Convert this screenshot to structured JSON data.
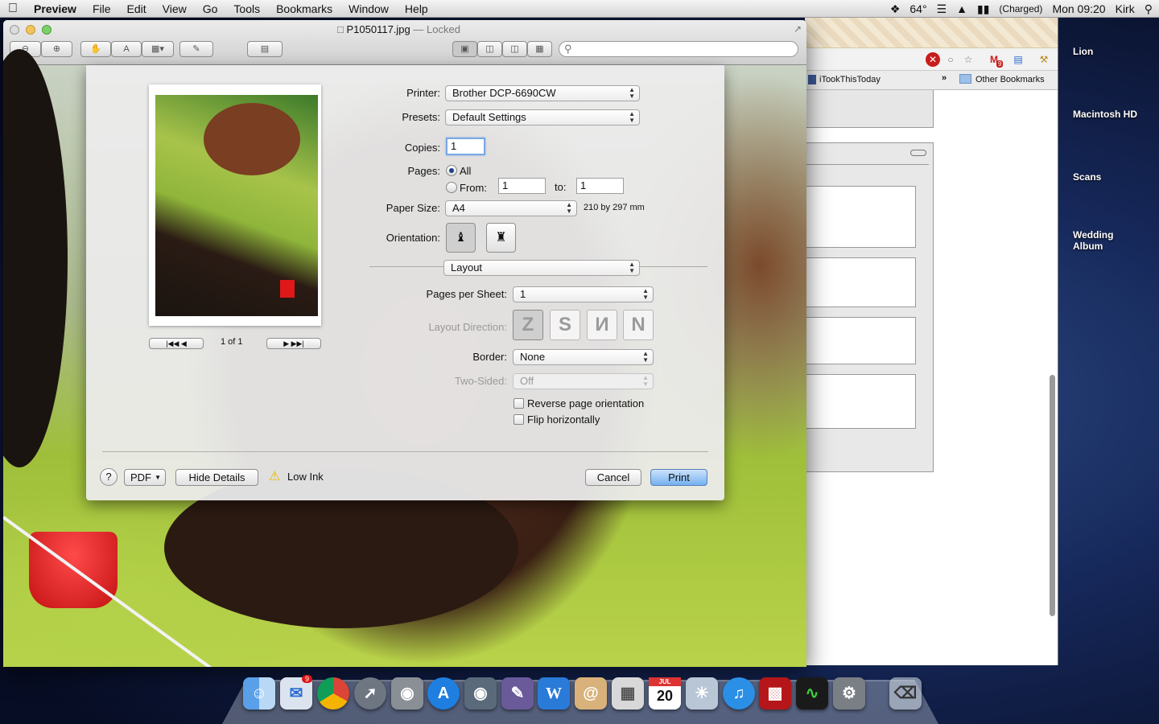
{
  "menubar": {
    "app_name": "Preview",
    "menus": [
      "File",
      "Edit",
      "View",
      "Go",
      "Tools",
      "Bookmarks",
      "Window",
      "Help"
    ],
    "temperature": "64°",
    "battery_status": "(Charged)",
    "clock": "Mon 09:20",
    "user": "Kirk"
  },
  "desktop": {
    "icons": [
      "Lion",
      "Macintosh HD",
      "Scans",
      "Wedding Album"
    ]
  },
  "browser": {
    "bookmark_item": "iTookThisToday",
    "chevron": "»",
    "other_bookmarks": "Other Bookmarks",
    "gmail_badge": "9"
  },
  "preview_window": {
    "filename": "P1050117.jpg",
    "separator": "—",
    "status": "Locked"
  },
  "print_dialog": {
    "printer_label": "Printer:",
    "printer_value": "Brother DCP-6690CW",
    "presets_label": "Presets:",
    "presets_value": "Default Settings",
    "copies_label": "Copies:",
    "copies_value": "1",
    "pages_label": "Pages:",
    "pages_all_label": "All",
    "pages_from_label": "From:",
    "pages_from_value": "1",
    "pages_to_label": "to:",
    "pages_to_value": "1",
    "paper_size_label": "Paper Size:",
    "paper_size_value": "A4",
    "paper_size_dims": "210 by 297 mm",
    "orientation_label": "Orientation:",
    "section_value": "Layout",
    "pages_per_sheet_label": "Pages per Sheet:",
    "pages_per_sheet_value": "1",
    "layout_direction_label": "Layout Direction:",
    "border_label": "Border:",
    "border_value": "None",
    "two_sided_label": "Two-Sided:",
    "two_sided_value": "Off",
    "reverse_label": "Reverse page orientation",
    "flip_label": "Flip horizontally",
    "page_counter": "1 of 1",
    "help_label": "?",
    "pdf_label": "PDF",
    "hide_details_label": "Hide Details",
    "low_ink_label": "Low Ink",
    "cancel_label": "Cancel",
    "print_label": "Print"
  },
  "dock": {
    "calendar_day": "20",
    "calendar_month": "JUL",
    "mail_badge": "9"
  }
}
